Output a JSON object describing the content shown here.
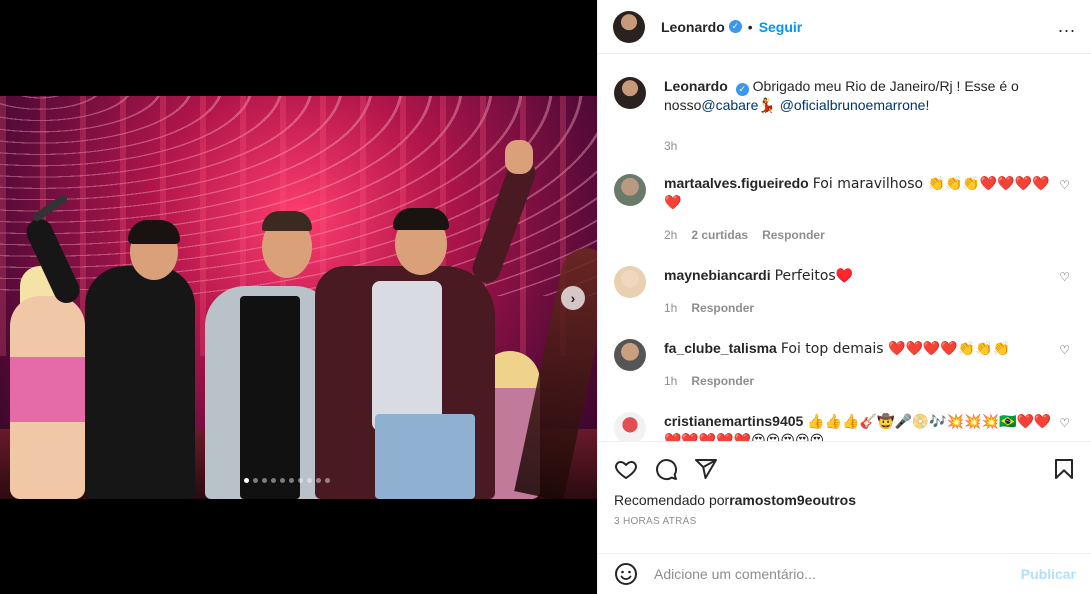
{
  "post": {
    "author": "Leonardo",
    "separator": "•",
    "follow_label": "Seguir",
    "more_label": "...",
    "caption_prefix": "Obrigado meu Rio de Janeiro/Rj ! Esse é o nosso",
    "mention1": "@cabare",
    "mention1_emoji": "💃",
    "mention2": "@oficialbrunoemarrone",
    "caption_suffix": "!",
    "caption_time": "3h"
  },
  "comments": [
    {
      "user": "martaalves.figueiredo",
      "text": "Foi maravilhoso 👏👏👏❤️❤️❤️❤️ ❤️",
      "time": "2h",
      "likes": "2 curtidas",
      "reply": "Responder"
    },
    {
      "user": "maynebiancardi",
      "text": "Perfeitos♥️",
      "time": "1h",
      "reply": "Responder"
    },
    {
      "user": "fa_clube_talisma",
      "text": "Foi top demais ❤️❤️❤️❤️👏👏👏",
      "time": "1h",
      "reply": "Responder"
    },
    {
      "user": "cristianemartins9405",
      "text": "👍👍👍🎸🤠🎤📀🎶💥💥💥🇧🇷❤️❤️❤️❤️❤️❤️❤️😍😍😍😍😍"
    }
  ],
  "carousel": {
    "next_label": "›",
    "dot_count": 10,
    "active_index": 0
  },
  "recommended": {
    "prefix": "Recomendado por",
    "user": "ramostom9",
    "connector": "e",
    "others": "outros"
  },
  "timestamp": "3 HORAS ATRÁS",
  "add_comment": {
    "placeholder": "Adicione um comentário...",
    "publish_label": "Publicar"
  },
  "colors": {
    "accent": "#0095f6",
    "publish_disabled": "#b2dffc",
    "text": "#262626",
    "muted": "#8e8e8e"
  }
}
